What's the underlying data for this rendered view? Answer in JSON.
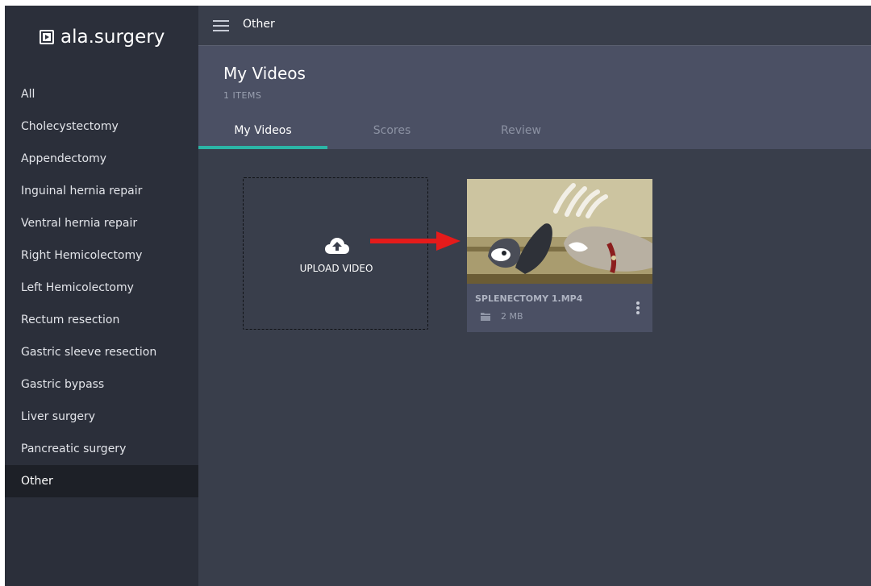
{
  "brand": {
    "name": "ala.surgery",
    "icon": "play-square-icon"
  },
  "sidebar": {
    "items": [
      {
        "label": "All"
      },
      {
        "label": "Cholecystectomy"
      },
      {
        "label": "Appendectomy"
      },
      {
        "label": "Inguinal hernia repair"
      },
      {
        "label": "Ventral hernia repair"
      },
      {
        "label": "Right Hemicolectomy"
      },
      {
        "label": "Left Hemicolectomy"
      },
      {
        "label": "Rectum resection"
      },
      {
        "label": "Gastric sleeve resection"
      },
      {
        "label": "Gastric bypass"
      },
      {
        "label": "Liver surgery"
      },
      {
        "label": "Pancreatic surgery"
      },
      {
        "label": "Other",
        "active": true
      }
    ]
  },
  "topbar": {
    "menu_icon": "hamburger-icon",
    "breadcrumb": "Other"
  },
  "header": {
    "title": "My Videos",
    "count": "1 ITEMS",
    "tabs": [
      {
        "label": "My Videos",
        "active": true
      },
      {
        "label": "Scores"
      },
      {
        "label": "Review"
      }
    ]
  },
  "upload": {
    "label": "UPLOAD VIDEO",
    "icon": "cloud-upload-icon"
  },
  "videos": [
    {
      "name": "SPLENECTOMY 1.MP4",
      "size": "2 MB",
      "file_icon": "file-icon",
      "menu_icon": "more-vertical-icon"
    }
  ],
  "annotation": {
    "color": "#e51b1b",
    "icon": "red-arrow-annotation"
  },
  "colors": {
    "sidebar_bg": "#2b2f3a",
    "active_item_bg": "#1d2027",
    "main_bg": "#393e4b",
    "header_bg": "#4b5064",
    "tab_accent": "#2bb5a6"
  }
}
